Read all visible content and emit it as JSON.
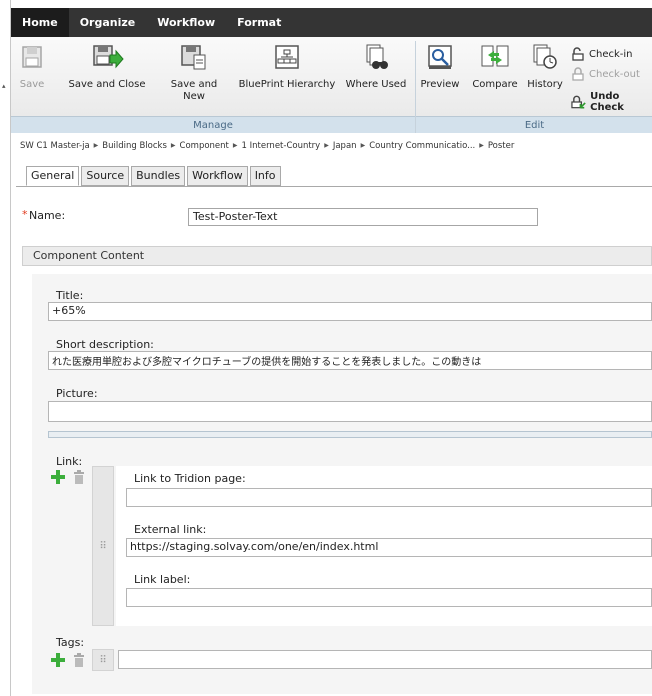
{
  "ribbon": {
    "tabs": [
      "Home",
      "Organize",
      "Workflow",
      "Format"
    ],
    "buttons": {
      "save": "Save",
      "save_close": "Save and Close",
      "save_new_1": "Save and",
      "save_new_2": "New",
      "blueprint": "BluePrint Hierarchy",
      "where_used": "Where Used",
      "preview": "Preview",
      "compare": "Compare",
      "history": "History",
      "check_in": "Check-in",
      "check_out": "Check-out",
      "undo_check": "Undo Check"
    },
    "groups": {
      "manage": "Manage",
      "edit": "Edit"
    }
  },
  "breadcrumb": [
    "SW C1 Master-ja",
    "Building Blocks",
    "Component",
    "1 Internet-Country",
    "Japan",
    "Country Communicatio...",
    "Poster"
  ],
  "form_tabs": [
    "General",
    "Source",
    "Bundles",
    "Workflow",
    "Info"
  ],
  "general": {
    "required_mark": "*",
    "name_label": "Name:",
    "name_value": "Test-Poster-Text"
  },
  "content": {
    "header": "Component Content",
    "title_label": "Title:",
    "title_value": "+65%",
    "short_desc_label": "Short description:",
    "short_desc_value": "れた医療用単腔および多腔マイクロチューブの提供を開始することを発表しました。この動きは",
    "picture_label": "Picture:",
    "picture_value": "",
    "link_label": "Link:",
    "link_tridion_label": "Link to Tridion page:",
    "link_tridion_value": "",
    "external_link_label": "External link:",
    "external_link_value": "https://staging.solvay.com/one/en/index.html",
    "link_label_label": "Link label:",
    "link_label_value": "",
    "tags_label": "Tags:",
    "tags_value": ""
  }
}
